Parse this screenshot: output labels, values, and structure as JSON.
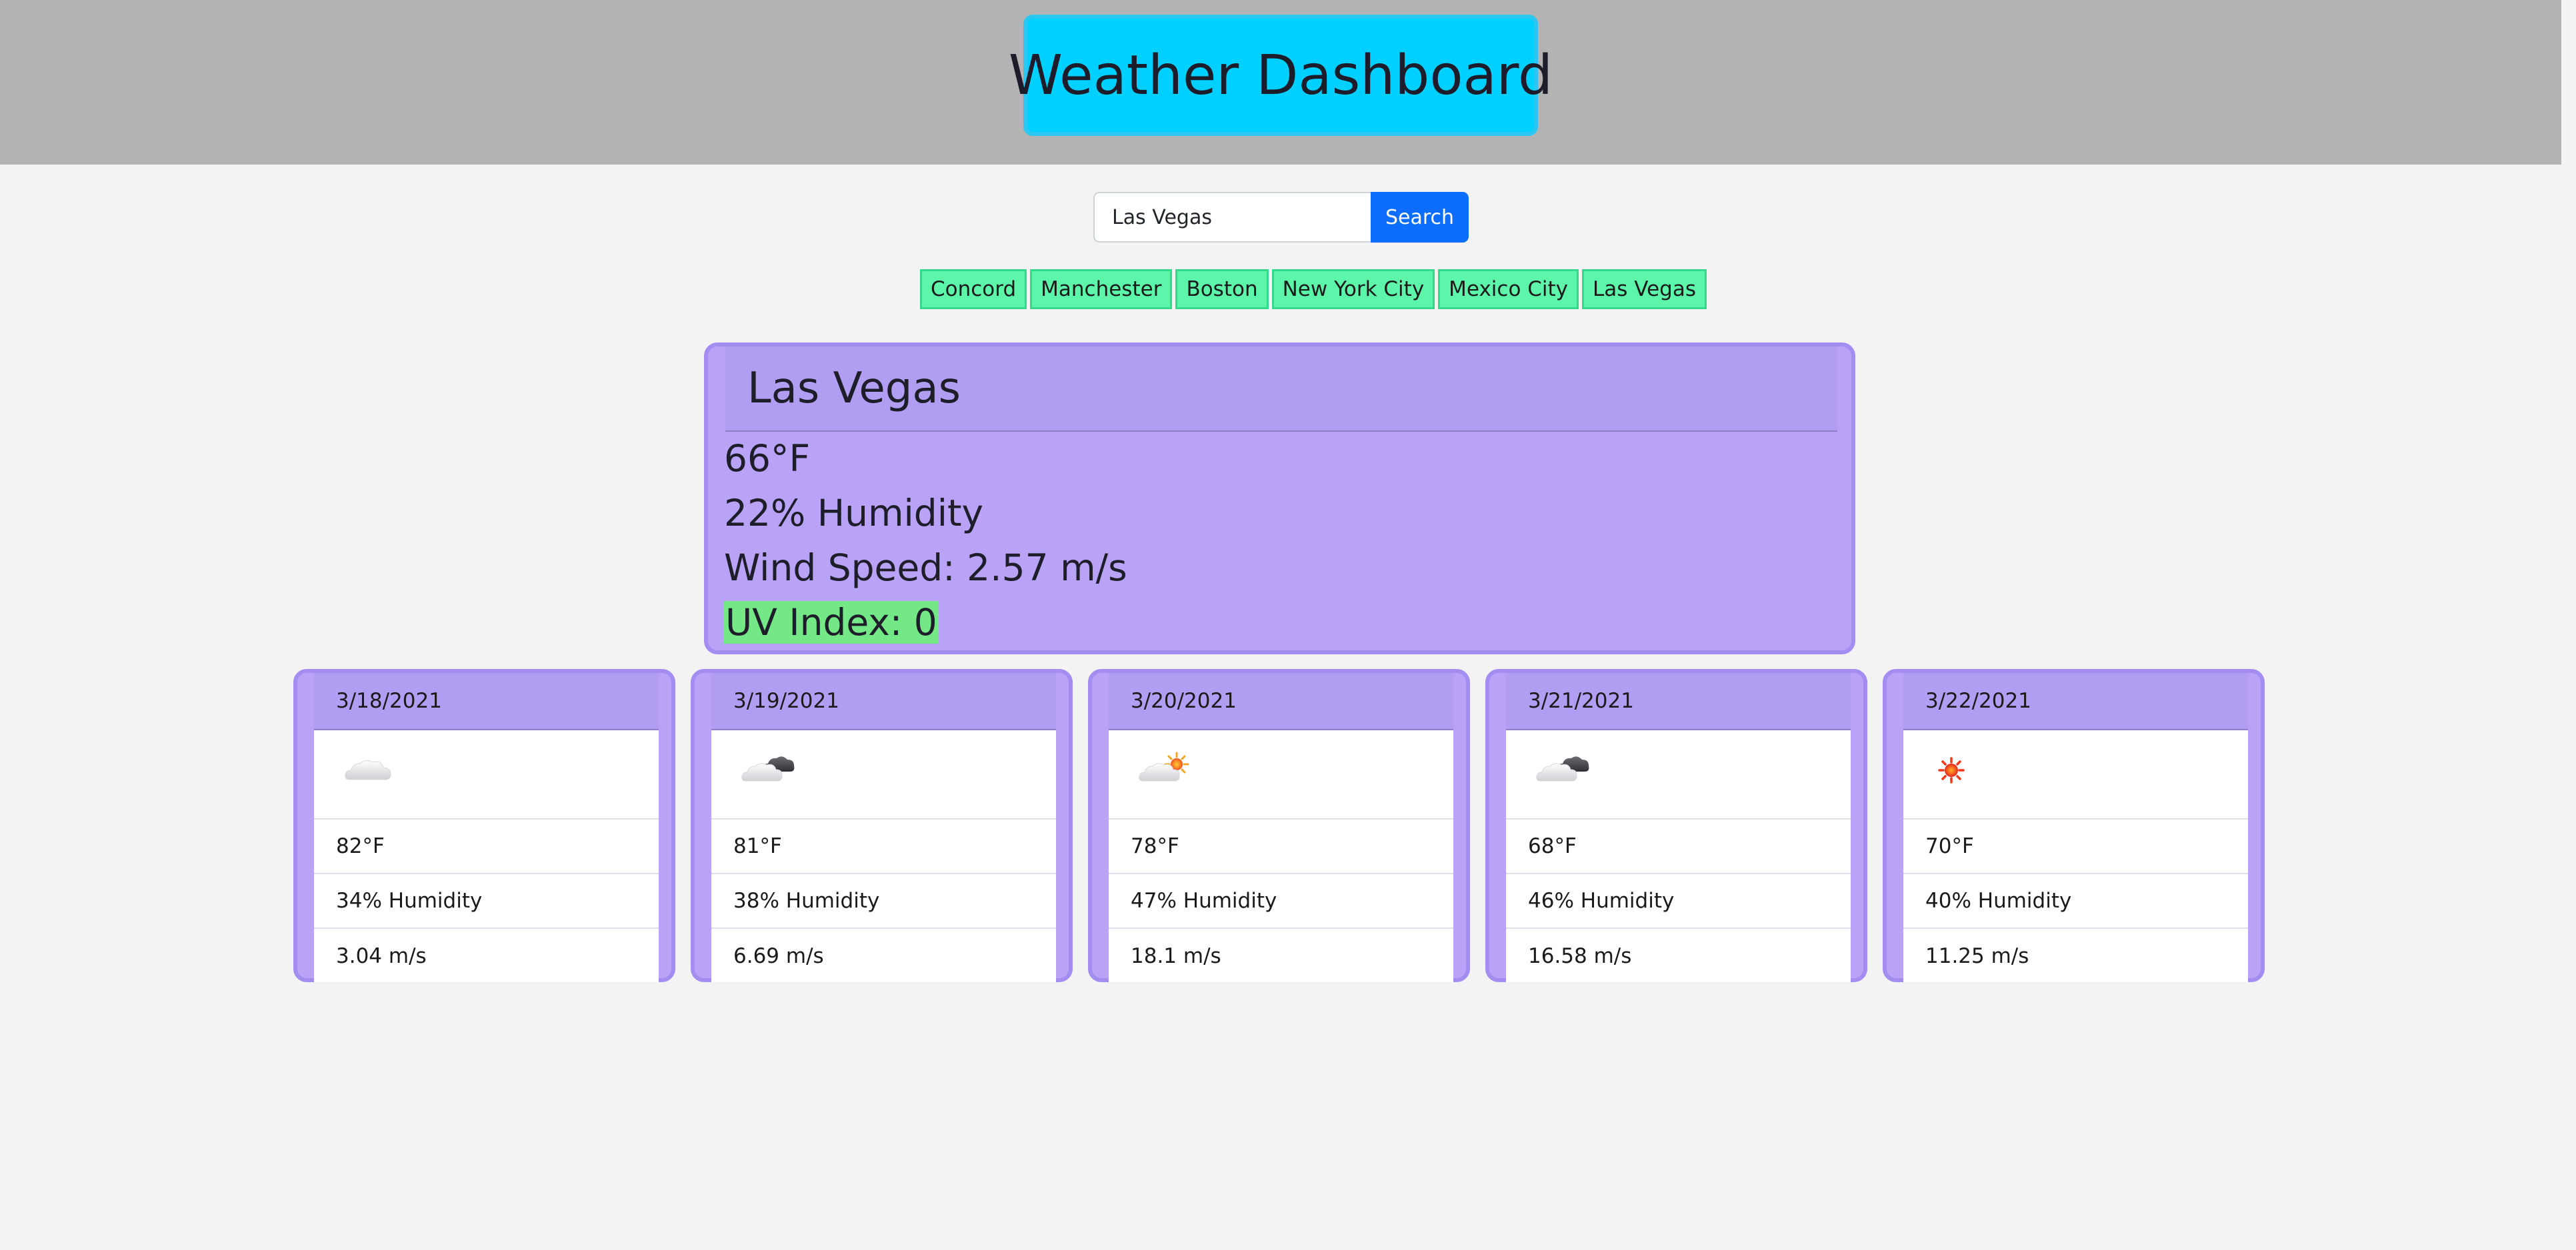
{
  "header": {
    "title": "Weather Dashboard"
  },
  "search": {
    "value": "Las Vegas",
    "button_label": "Search"
  },
  "history": [
    "Concord",
    "Manchester",
    "Boston",
    "New York City",
    "Mexico City",
    "Las Vegas"
  ],
  "current": {
    "city": "Las Vegas",
    "temperature": "66°F",
    "humidity": "22% Humidity",
    "wind": "Wind Speed: 2.57 m/s",
    "uv": "UV Index: 0",
    "uv_color": "#74e886"
  },
  "forecast": [
    {
      "date": "3/18/2021",
      "icon": "cloud-icon",
      "temp": "82°F",
      "humidity": "34% Humidity",
      "wind": "3.04 m/s"
    },
    {
      "date": "3/19/2021",
      "icon": "broken-clouds-icon",
      "temp": "81°F",
      "humidity": "38% Humidity",
      "wind": "6.69 m/s"
    },
    {
      "date": "3/20/2021",
      "icon": "partly-cloudy-icon",
      "temp": "78°F",
      "humidity": "47% Humidity",
      "wind": "18.1 m/s"
    },
    {
      "date": "3/21/2021",
      "icon": "broken-clouds-icon",
      "temp": "68°F",
      "humidity": "46% Humidity",
      "wind": "16.58 m/s"
    },
    {
      "date": "3/22/2021",
      "icon": "sun-icon",
      "temp": "70°F",
      "humidity": "40% Humidity",
      "wind": "11.25 m/s"
    }
  ],
  "colors": {
    "header_bg": "#b3b3b3",
    "title_bg": "#00d0ff",
    "card_bg": "#b8a3f7",
    "history_bg": "#5cf5a9",
    "button_bg": "#0d6efd"
  }
}
